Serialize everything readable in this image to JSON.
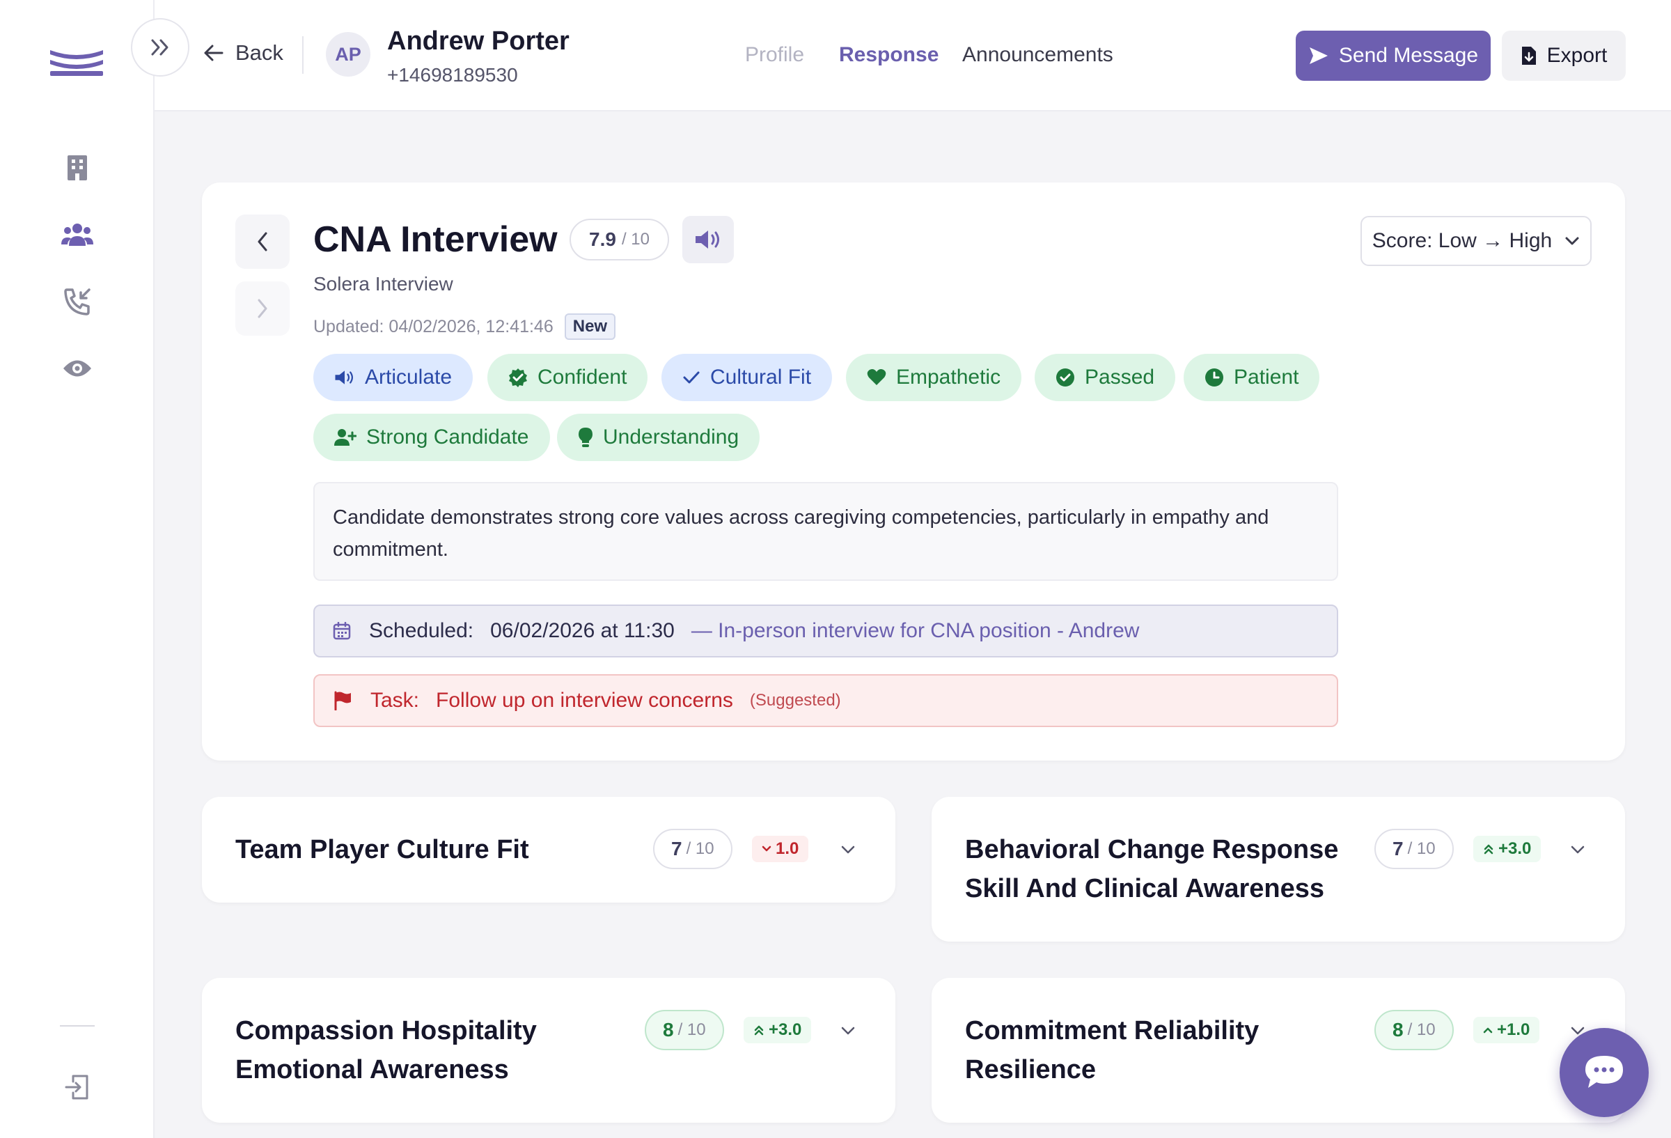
{
  "header": {
    "back_label": "Back",
    "avatar_initials": "AP",
    "candidate_name": "Andrew Porter",
    "candidate_phone": "+14698189530",
    "tabs": [
      {
        "label": "Profile",
        "state": "disabled"
      },
      {
        "label": "Response",
        "state": "active"
      },
      {
        "label": "Announcements",
        "state": "normal"
      }
    ],
    "send_message_label": "Send Message",
    "export_label": "Export"
  },
  "interview": {
    "title": "CNA Interview",
    "score": "7.9",
    "score_max": "/ 10",
    "subtitle": "Solera Interview",
    "updated": "Updated: 04/02/2026, 12:41:46",
    "badge": "New",
    "sort_label": "Score: Low → High",
    "tags": [
      {
        "label": "Articulate",
        "icon": "speaker-icon",
        "tone": "blue"
      },
      {
        "label": "Confident",
        "icon": "badge-check-icon",
        "tone": "green"
      },
      {
        "label": "Cultural Fit",
        "icon": "check-icon",
        "tone": "blue"
      },
      {
        "label": "Empathetic",
        "icon": "heart-icon",
        "tone": "green"
      },
      {
        "label": "Passed",
        "icon": "check-circle-icon",
        "tone": "green"
      },
      {
        "label": "Patient",
        "icon": "clock-icon",
        "tone": "green"
      },
      {
        "label": "Strong Candidate",
        "icon": "user-plus-icon",
        "tone": "green"
      },
      {
        "label": "Understanding",
        "icon": "lightbulb-icon",
        "tone": "green"
      }
    ],
    "summary": "Candidate demonstrates strong core values across caregiving competencies, particularly in empathy and commitment.",
    "scheduled_label": "Scheduled:",
    "scheduled_datetime": "06/02/2026 at 11:30",
    "scheduled_desc": "— In-person interview for CNA position - Andrew",
    "task_label": "Task:",
    "task_text": "Follow up on interview concerns",
    "task_note": "(Suggested)"
  },
  "sections": [
    {
      "title_lines": [
        "Team Player Culture Fit"
      ],
      "score": "7",
      "score_max": "/ 10",
      "delta": "1.0",
      "delta_dir": "down",
      "tone": "gray"
    },
    {
      "title_lines": [
        "Behavioral Change Response",
        "Skill And Clinical Awareness"
      ],
      "score": "7",
      "score_max": "/ 10",
      "delta": "+3.0",
      "delta_dir": "up-double",
      "tone": "gray"
    },
    {
      "title_lines": [
        "Compassion Hospitality",
        "Emotional Awareness"
      ],
      "score": "8",
      "score_max": "/ 10",
      "delta": "+3.0",
      "delta_dir": "up-double",
      "tone": "green"
    },
    {
      "title_lines": [
        "Commitment Reliability",
        "Resilience"
      ],
      "score": "8",
      "score_max": "/ 10",
      "delta": "+1.0",
      "delta_dir": "up",
      "tone": "green"
    }
  ],
  "colors": {
    "accent": "#6d5fb0",
    "success": "#1e7a3c",
    "danger": "#c0262d",
    "info": "#2b4aa8"
  }
}
